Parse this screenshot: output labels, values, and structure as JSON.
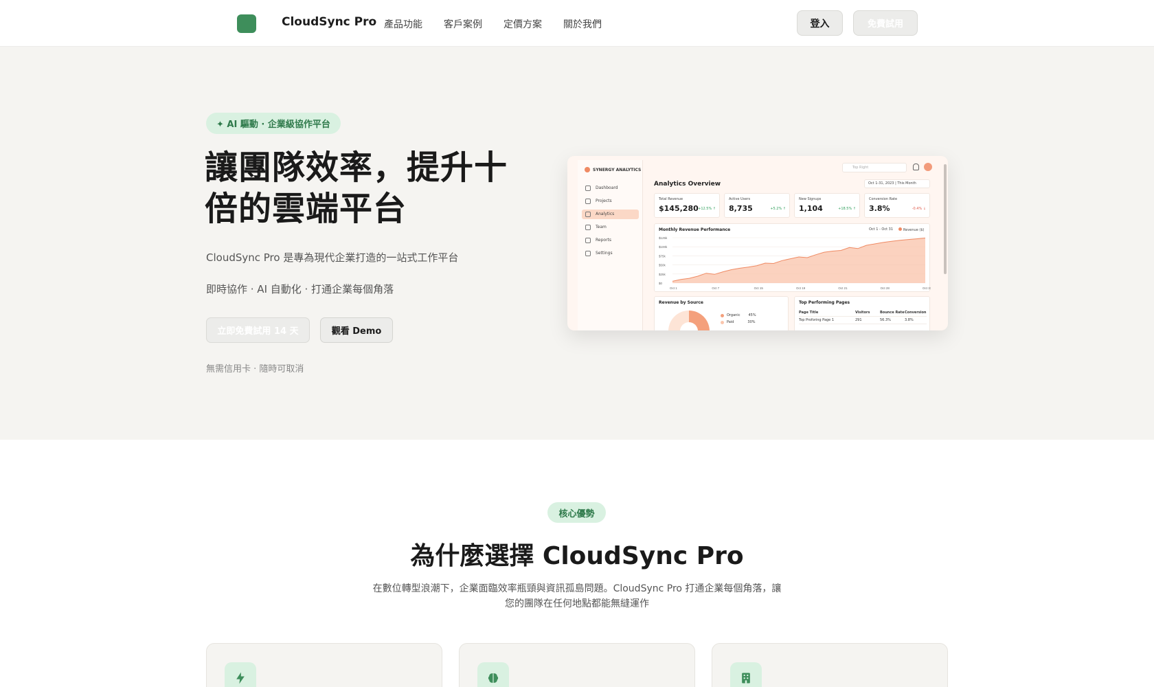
{
  "nav": {
    "brand": "CloudSync Pro",
    "links": [
      "產品功能",
      "客戶案例",
      "定價方案",
      "關於我們"
    ],
    "login_label": "登入",
    "trial_label": "免費試用"
  },
  "hero": {
    "badge": "✦ AI 驅動 · 企業級協作平台",
    "title": "讓團隊效率，提升十倍的雲端平台",
    "subtitle1": "CloudSync Pro 是專為現代企業打造的一站式工作平台",
    "subtitle2": "即時協作 · AI 自動化 · 打通企業每個角落",
    "primary_cta": "立即免費試用 14 天",
    "secondary_cta": "觀看 Demo",
    "note": "無需信用卡 · 隨時可取消"
  },
  "dashboard": {
    "brand": "SYNERGY ANALYTICS",
    "nav": [
      "Dashboard",
      "Projects",
      "Analytics",
      "Team",
      "Reports",
      "Settings"
    ],
    "active": "Analytics",
    "search_placeholder": "Top Right",
    "title": "Analytics Overview",
    "date_range": "Oct 1-31, 2023 | This Month",
    "kpis": [
      {
        "label": "Total Revenue",
        "value": "$145,280",
        "delta": "+12.5% ↑",
        "color": "#2f9e5a"
      },
      {
        "label": "Active Users",
        "value": "8,735",
        "delta": "+5.2% ↑",
        "color": "#2f9e5a"
      },
      {
        "label": "New Signups",
        "value": "1,104",
        "delta": "+18.5% ↑",
        "color": "#2f9e5a"
      },
      {
        "label": "Conversion Rate",
        "value": "3.8%",
        "delta": "-0.4% ↓",
        "color": "#e05a4b"
      }
    ],
    "revenue_chart_title": "Monthly Revenue Performance",
    "revenue_chart_range": "Oct 1 - Oct 31",
    "revenue_chart_legend": "Revenue ($)",
    "source_title": "Revenue by Source",
    "sources": [
      {
        "name": "Organic",
        "pct": "45%",
        "color": "#f4a07c"
      },
      {
        "name": "Paid",
        "pct": "30%",
        "color": "#fbc6ad"
      }
    ],
    "pages_title": "Top Performing Pages",
    "pages_columns": [
      "Page Title",
      "Visitors",
      "Bounce Rate",
      "Conversion"
    ],
    "pages_rows": [
      [
        "Top Proforing Page 1",
        "291",
        "56.3%",
        "3.8%"
      ]
    ]
  },
  "chart_data": {
    "type": "area",
    "title": "Monthly Revenue Performance",
    "x": [
      "Oct 1",
      "Oct 7",
      "Oct 15",
      "Oct 19",
      "Oct 21",
      "Oct 28",
      "Oct 31"
    ],
    "ytick_labels": [
      "$0",
      "$25k",
      "$50k",
      "$75k",
      "$100k",
      "$125k"
    ],
    "ylim": [
      0,
      125000
    ],
    "series": [
      {
        "name": "Revenue ($)",
        "values": [
          5000,
          10000,
          13000,
          19000,
          27000,
          24000,
          31000,
          37000,
          41000,
          44000,
          48000,
          55000,
          54000,
          62000,
          67000,
          72000,
          70000,
          78000,
          85000,
          88000,
          90000,
          98000,
          95000,
          104000,
          108000,
          112000,
          115000,
          118000,
          120000,
          122000,
          124000
        ]
      }
    ],
    "grid": true,
    "legend": "top-right"
  },
  "features": {
    "badge": "核心優勢",
    "title": "為什麼選擇 CloudSync Pro",
    "description": "在數位轉型浪潮下，企業面臨效率瓶頸與資訊孤島問題。CloudSync Pro 打通企業每個角落，讓您的團隊在任何地點都能無縫運作",
    "cards": [
      {
        "icon": "lightning-icon"
      },
      {
        "icon": "brain-icon"
      },
      {
        "icon": "building-icon"
      }
    ]
  },
  "colors": {
    "accent": "#3e8e5b",
    "badge_bg": "#d9f1e1",
    "hero_bg": "#f5f4f1",
    "chart_fill": "#f4a07c"
  }
}
